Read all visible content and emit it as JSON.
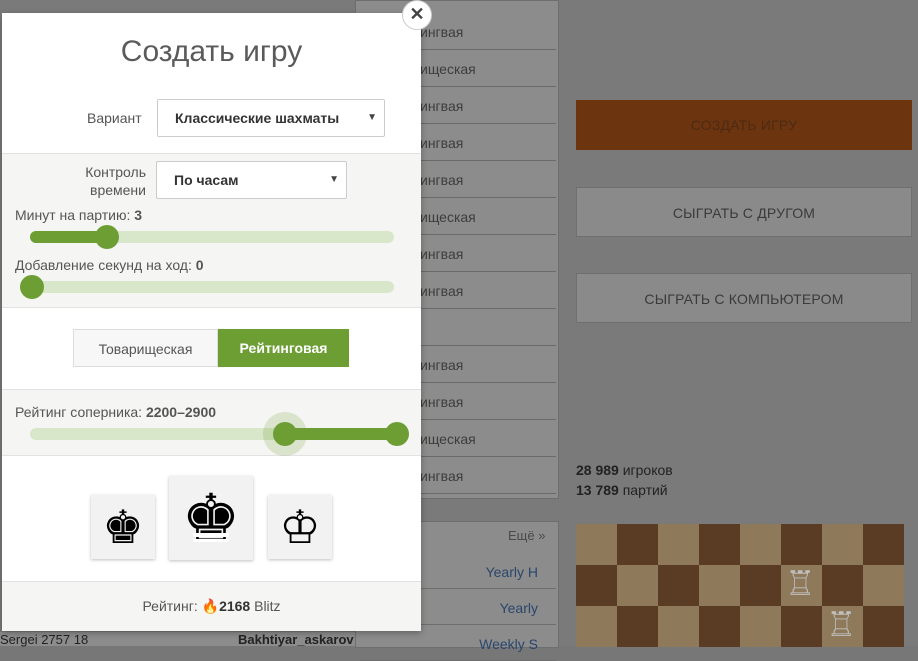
{
  "background": {
    "mid_rows": [
      "ингвая",
      "ищеская",
      "ингвая",
      "ингвая",
      "ингвая",
      "ищеская",
      "ингвая",
      "ингвая",
      "",
      "ингвая",
      "ингвая",
      "ищеская",
      "ингвая"
    ],
    "more_label": "Ещё »",
    "lower_rows": [
      "Yearly H",
      "Yearly",
      "Weekly S"
    ],
    "bottom_left_text": "Sergei  2757  18",
    "bottom_mid_text": "Bakhtiyar_askarov",
    "buttons": {
      "create": "СОЗДАТЬ ИГРУ",
      "play_friend": "СЫГРАТЬ С ДРУГОМ",
      "play_computer": "СЫГРАТЬ С КОМПЬЮТЕРОМ"
    },
    "stats": {
      "players_count": "28 989",
      "players_label": "игроков",
      "games_count": "13 789",
      "games_label": "партий"
    }
  },
  "modal": {
    "title": "Создать игру",
    "variant": {
      "label": "Вариант",
      "value": "Классические шахматы"
    },
    "time_control": {
      "label": "Контроль времени",
      "value": "По часам"
    },
    "minutes": {
      "label": "Минут на партию: ",
      "value": "3",
      "fraction": 0.2
    },
    "increment": {
      "label": "Добавление секунд на ход: ",
      "value": "0",
      "fraction": 0.0
    },
    "mode": {
      "casual": "Товарищеская",
      "rated": "Рейтинговая",
      "selected": "rated"
    },
    "rating_range": {
      "label": "Рейтинг соперника: ",
      "value": "2200–2900",
      "low_fraction": 0.7,
      "high_fraction": 1.0
    },
    "colors": [
      "black",
      "random",
      "white"
    ],
    "footer": {
      "label": "Рейтинг:",
      "value": "2168",
      "type": "Blitz"
    },
    "accent_color": "#6c9e34"
  }
}
